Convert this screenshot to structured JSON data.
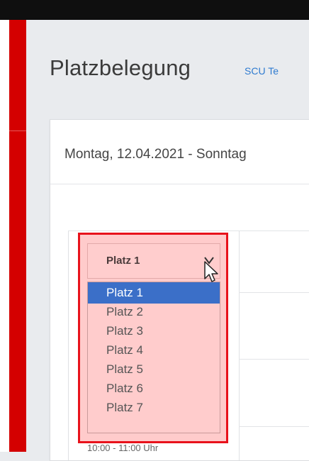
{
  "header": {
    "title": "Platzbelegung",
    "club_link": "SCU Te"
  },
  "card": {
    "date_range": "Montag, 12.04.2021 - Sonntag"
  },
  "court_select": {
    "value": "Platz 1",
    "options": [
      "Platz 1",
      "Platz 2",
      "Platz 3",
      "Platz 4",
      "Platz 5",
      "Platz 6",
      "Platz 7"
    ],
    "selected": "Platz 1"
  },
  "time_slot": "10:00 - 11:00 Uhr",
  "colors": {
    "accent_red": "#d40000",
    "highlight_red": "#e8121b",
    "selection_blue": "#3b6fc8",
    "link_blue": "#2f7bd0"
  }
}
